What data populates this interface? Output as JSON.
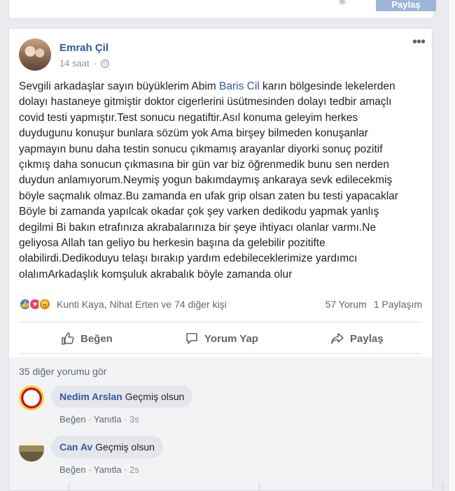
{
  "top_card": {
    "share_label": "Paylaş"
  },
  "post": {
    "author": "Emrah Çil",
    "time": "14 saat",
    "privacy_icon": "globe-icon",
    "text_before_mention": "Sevgili arkadaşlar sayın büyüklerim Abim ",
    "mention": "Baris Cil",
    "text_after_mention": " karın bölgesinde lekelerden\ndolayı hastaneye gitmiştir doktor cigerlerini üsütmesinden dolayı tedbir amaçlı\ncovid testi yapmıştır.Test sonucu negatiftir.Asıl konuma geleyim herkes\nduydugunu konuşur bunlara sözüm yok Ama birşey bilmeden konuşanlar\nyapmayın bunu daha testin sonucu çıkmamış arayanlar diyorki sonuç pozitif\nçıkmış daha sonucun çıkmasına bir gün var biz öğrenmedik bunu sen nerden\nduydun anlamıyorum.Neymiş yogun bakımdaymış ankaraya sevk edilecekmiş\nböyle saçmalık olmaz.Bu zamanda en ufak grip olsan zaten bu testi yapacaklar\nBöyle bi zamanda yapılcak okadar çok şey varken dedikodu yapmak yanlış\ndegilmi Bi bakın etrafınıza akrabalarınıza bir şeye ihtiyacı olanlar varmı.Ne\ngeliyosa Allah tan geliyo bu herkesin başına da gelebilir pozitifte\nolabilirdi.Dedikoduyu telaşı bırakıp yardım edebileceklerimize yardımcı\nolalımArkadaşlık komşuluk akrabalık böyle zamanda olur",
    "reactions_text": "Kunti Kaya, Nihat Erten ve 74 diğer kişi",
    "comments_count": "57 Yorum",
    "shares_count": "1 Paylaşım"
  },
  "actions": {
    "like": "Beğen",
    "comment": "Yorum Yap",
    "share": "Paylaş"
  },
  "comments": {
    "more_label": "35 diğer yorumu gör",
    "items": [
      {
        "name": "Nedim Arslan",
        "text": "Geçmiş olsun",
        "like": "Beğen",
        "reply": "Yanıtla",
        "time": "3s"
      },
      {
        "name": "Can Av",
        "text": "Geçmiş olsun",
        "like": "Beğen",
        "reply": "Yanıtla",
        "time": "2s"
      }
    ]
  }
}
